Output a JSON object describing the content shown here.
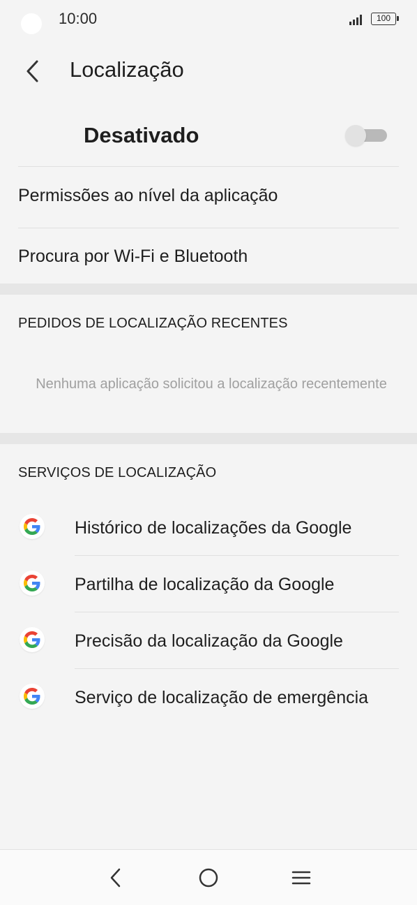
{
  "status_bar": {
    "time": "10:00",
    "battery": "100",
    "icons": [
      "camera-hole",
      "signal-icon",
      "battery-icon"
    ]
  },
  "header": {
    "back_icon": "chevron-left-icon",
    "title": "Localização"
  },
  "master_toggle": {
    "label": "Desativado",
    "state": "off"
  },
  "settings": [
    {
      "label": "Permissões ao nível da aplicação"
    },
    {
      "label": "Procura por Wi-Fi e Bluetooth"
    }
  ],
  "recent_requests": {
    "header": "PEDIDOS DE LOCALIZAÇÃO RECENTES",
    "empty_text": "Nenhuma aplicação solicitou a localização recentemente"
  },
  "services": {
    "header": "SERVIÇOS DE LOCALIZAÇÃO",
    "items": [
      {
        "icon": "google-g-icon",
        "label": "Histórico de localizações da Google"
      },
      {
        "icon": "google-g-icon",
        "label": "Partilha de localização da Google"
      },
      {
        "icon": "google-g-icon",
        "label": "Precisão da localização da Google"
      },
      {
        "icon": "google-g-icon",
        "label": "Serviço de localização de emergência"
      }
    ]
  },
  "nav_bar": {
    "buttons": [
      "back-nav-icon",
      "home-nav-icon",
      "menu-nav-icon"
    ]
  },
  "colors": {
    "background": "#f4f4f4",
    "section_gap": "#e6e6e6",
    "toggle_off": "#b9b9b9",
    "google_blue": "#4285F4",
    "google_red": "#EA4335",
    "google_yellow": "#FBBC05",
    "google_green": "#34A853"
  }
}
